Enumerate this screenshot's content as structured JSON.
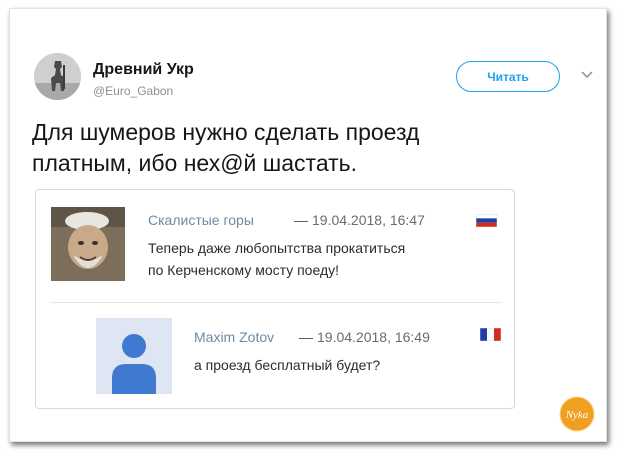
{
  "tweet": {
    "author_name": "Древний Укр",
    "author_handle": "@Euro_Gabon",
    "follow_label": "Читать",
    "text_line1": "Для шумеров нужно сделать проезд",
    "text_line2": "платным, ибо нех@й шастать."
  },
  "comments": [
    {
      "author": "Скалистые горы",
      "separator": "—",
      "datetime": "19.04.2018, 16:47",
      "text_line1": "Теперь даже любопытства прокатиться",
      "text_line2": "по Керченскому мосту поеду!",
      "flag": "russia-flag-icon"
    },
    {
      "author": "Maxim Zotov",
      "separator": "—",
      "datetime": "19.04.2018, 16:49",
      "text": "а проезд бесплатный будет?",
      "flag": "france-flag-icon"
    }
  ],
  "watermark": {
    "text": "Nyka",
    "color": "#f0a020"
  },
  "colors": {
    "accent": "#1da1f2",
    "comment_author": "#6b8ba7"
  }
}
